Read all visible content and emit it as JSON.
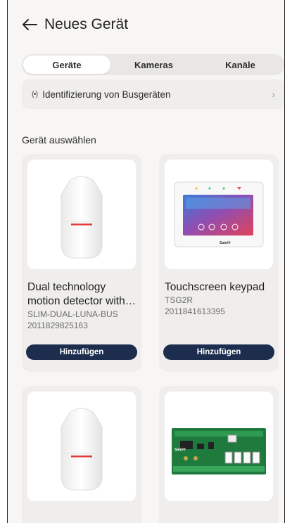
{
  "header": {
    "title": "Neues Gerät"
  },
  "tabs": [
    {
      "label": "Geräte",
      "active": true
    },
    {
      "label": "Kameras",
      "active": false
    },
    {
      "label": "Kanäle",
      "active": false
    }
  ],
  "bus_row": {
    "label": "Identifizierung von Busgeräten"
  },
  "section_title": "Gerät auswählen",
  "devices": [
    {
      "name": "Dual technology motion detector with bus",
      "model": "SLIM-DUAL-LUNA-BUS",
      "code": "2011829825163",
      "button": "Hinzufügen"
    },
    {
      "name": "Touchscreen keypad",
      "model": "TSG2R",
      "code": "2011841613395",
      "button": "Hinzufügen"
    },
    {
      "name": "",
      "model": "",
      "code": "",
      "button": ""
    },
    {
      "name": "",
      "model": "",
      "code": "",
      "button": ""
    }
  ],
  "keypad_brand": "Satel®",
  "module_brand": "Satel®",
  "colors": {
    "accent": "#1c2d4d",
    "background": "#f7f6f4"
  }
}
